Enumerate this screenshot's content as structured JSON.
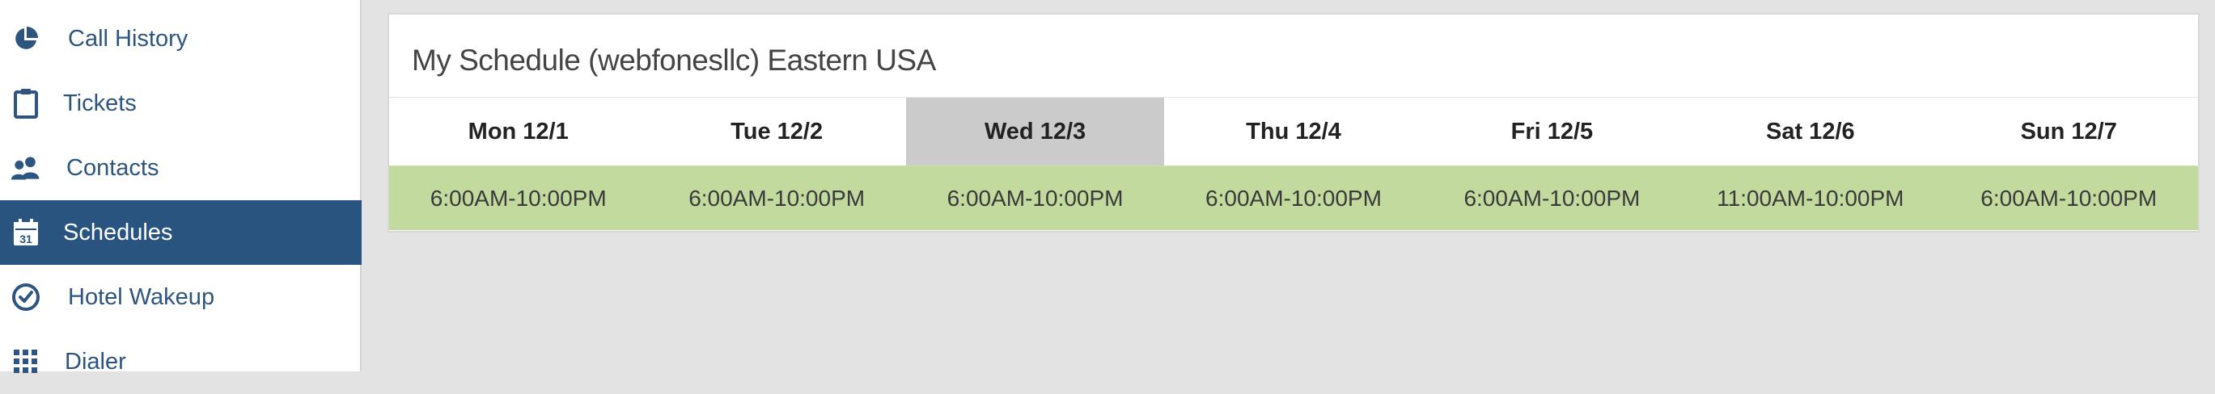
{
  "sidebar": {
    "items": [
      {
        "label": "Call History",
        "icon": "pie-chart-icon",
        "active": false
      },
      {
        "label": "Tickets",
        "icon": "clipboard-icon",
        "active": false
      },
      {
        "label": "Contacts",
        "icon": "users-icon",
        "active": false
      },
      {
        "label": "Schedules",
        "icon": "calendar-icon",
        "active": true,
        "icon_text": "31"
      },
      {
        "label": "Hotel Wakeup",
        "icon": "clock-check-icon",
        "active": false
      },
      {
        "label": "Dialer",
        "icon": "keypad-icon",
        "active": false
      }
    ]
  },
  "schedule": {
    "title": "My Schedule (webfonesllc) Eastern USA",
    "days": [
      {
        "label": "Mon 12/1",
        "hours": "6:00AM-10:00PM",
        "today": false
      },
      {
        "label": "Tue 12/2",
        "hours": "6:00AM-10:00PM",
        "today": false
      },
      {
        "label": "Wed 12/3",
        "hours": "6:00AM-10:00PM",
        "today": true
      },
      {
        "label": "Thu 12/4",
        "hours": "6:00AM-10:00PM",
        "today": false
      },
      {
        "label": "Fri 12/5",
        "hours": "6:00AM-10:00PM",
        "today": false
      },
      {
        "label": "Sat 12/6",
        "hours": "11:00AM-10:00PM",
        "today": false
      },
      {
        "label": "Sun 12/7",
        "hours": "6:00AM-10:00PM",
        "today": false
      }
    ]
  },
  "colors": {
    "sidebar_active_bg": "#28547f",
    "sidebar_text": "#2d5580",
    "hours_row_bg": "#c3da9f",
    "today_header_bg": "#cbcbcb",
    "page_bg": "#e3e3e3"
  }
}
